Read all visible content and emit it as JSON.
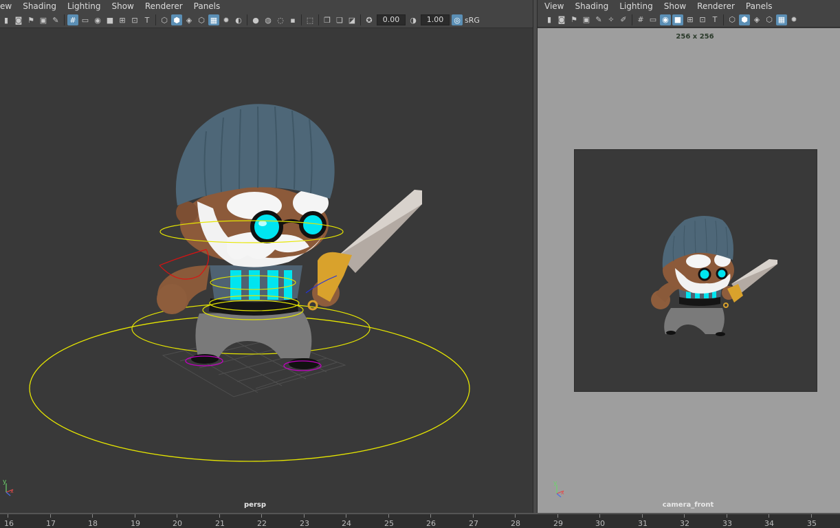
{
  "left_panel": {
    "menu": [
      "ew",
      "Shading",
      "Lighting",
      "Show",
      "Renderer",
      "Panels"
    ],
    "exposure_value": "0.00",
    "gamma_value": "1.00",
    "color_space": "sRG",
    "camera_label": "persp"
  },
  "right_panel": {
    "menu": [
      "View",
      "Shading",
      "Lighting",
      "Show",
      "Renderer",
      "Panels"
    ],
    "resolution_label": "256 x 256",
    "camera_label": "camera_front"
  },
  "axis_labels": {
    "y": "y",
    "x": "x"
  },
  "timeline": {
    "ticks": [
      "16",
      "17",
      "18",
      "19",
      "20",
      "21",
      "22",
      "23",
      "24",
      "25",
      "26",
      "27",
      "28",
      "29",
      "30",
      "31",
      "32",
      "33",
      "34",
      "35"
    ]
  },
  "colors": {
    "control_yellow": "#e6e600",
    "foot_control_magenta": "#c000c0",
    "active_icon": "#5b8fb5",
    "glasses_cyan": "#00e5f0"
  }
}
